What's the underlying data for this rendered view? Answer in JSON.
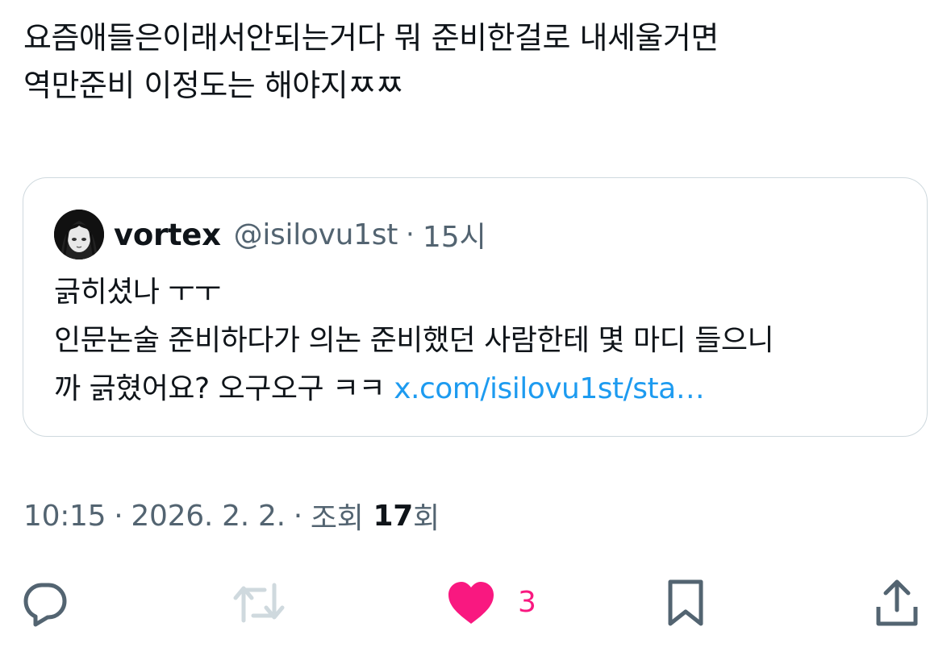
{
  "tweet": {
    "text_line1": "요즘애들은이래서안되는거다 뭐 준비한걸로 내세울거면",
    "text_line2": "역만준비 이정도는 해야지ㅉㅉ"
  },
  "quote": {
    "author_name": "vortex",
    "author_handle": "@isilovu1st",
    "separator": "·",
    "time": "15시",
    "line1": "긁히셨나 ㅜㅜ",
    "line2": "인문논술 준비하다가 의논 준비했던 사람한테 몇 마디 들으니",
    "line3_text": "까 긁혔어요? 오구오구 ㅋㅋ ",
    "line3_link": "x.com/isilovu1st/sta…"
  },
  "meta": {
    "time": "10:15",
    "date": "2026. 2. 2.",
    "separator": "·",
    "views_label": "조회",
    "views_count": "17",
    "views_suffix": "회"
  },
  "actions": {
    "reply_icon": "reply-icon",
    "retweet_icon": "retweet-icon",
    "like_icon": "heart-filled-icon",
    "like_count": "3",
    "bookmark_icon": "bookmark-icon",
    "share_icon": "share-icon"
  },
  "colors": {
    "text_primary": "#0f1419",
    "text_secondary": "#536471",
    "link": "#1d9bf0",
    "like": "#f91880",
    "border": "#cfd9de",
    "retweet_disabled": "#cfd9de"
  }
}
